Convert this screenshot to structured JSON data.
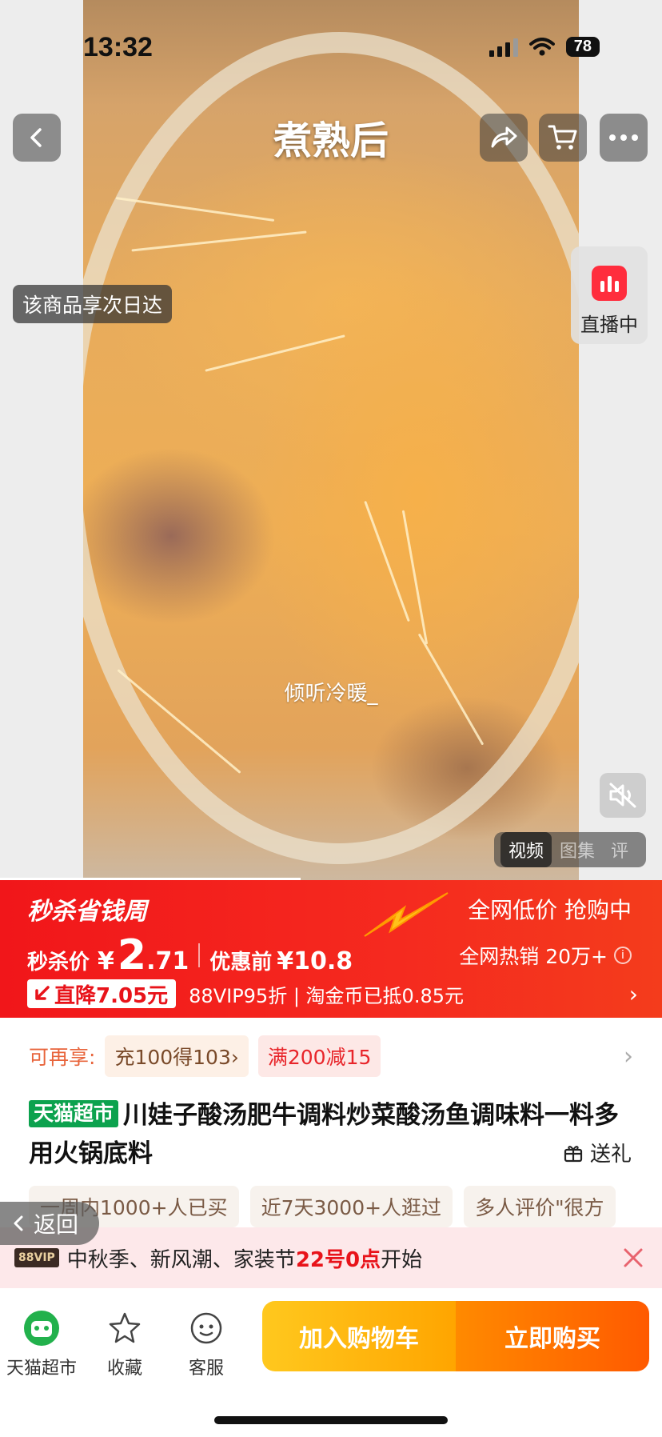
{
  "status_bar": {
    "time": "13:32",
    "battery": "78"
  },
  "media": {
    "title": "煮熟后",
    "next_day_tag": "该商品享次日达",
    "live_label": "直播中",
    "watermark": "倾听冷暖_",
    "tabs": [
      "视频",
      "图集",
      "评"
    ],
    "progress": 0.52
  },
  "flash_sale": {
    "logo": "秒杀省钱周",
    "tagline": "全网低价 抢购中",
    "price_label": "秒杀价",
    "currency": "¥",
    "price_int": "2",
    "price_dec": ".71",
    "before_label": "优惠前",
    "before_price": "¥10.8",
    "hot_sales": "全网热销 20万+",
    "drop_badge": "直降7.05元",
    "drop_detail": "88VIP95折 | 淘金币已抵0.85元"
  },
  "coupons": {
    "label": "可再享:",
    "items": [
      "充100得103›",
      "满200减15"
    ]
  },
  "product": {
    "store_badge": "天猫超市",
    "title": "川娃子酸汤肥牛调料炒菜酸汤鱼调味料一料多用火锅底料",
    "gift_label": "送礼"
  },
  "highlights": [
    "一周内1000+人已买",
    "近7天3000+人逛过",
    "多人评价\"很方"
  ],
  "back_label": "返回",
  "promo": {
    "vip_tag": "88VIP",
    "text_before": "中秋季、新风潮、家装节",
    "highlight": "22号0点",
    "text_after": "开始"
  },
  "bottom_bar": {
    "store_label": "天猫超市",
    "favorite_label": "收藏",
    "service_label": "客服",
    "add_cart_label": "加入购物车",
    "buy_now_label": "立即购买"
  },
  "colors": {
    "flash_red": "#f1161a",
    "store_green": "#0ca24e",
    "cart_yellow": "#ffc81e",
    "buy_orange": "#ff6a00"
  }
}
